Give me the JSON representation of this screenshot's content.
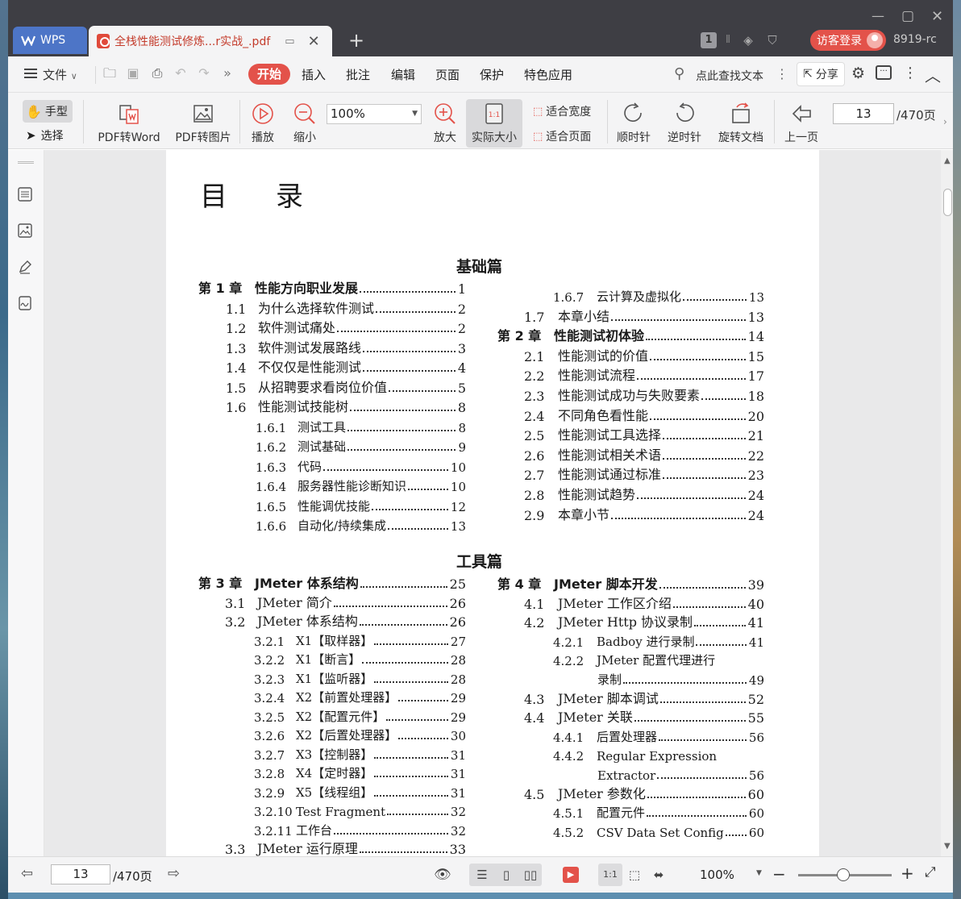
{
  "window": {
    "wps_tab_label": "WPS",
    "doc_tab_title": "全栈性能测试修炼...r实战_.pdf",
    "badge_count": "1",
    "login_label": "访客登录",
    "version": "8919-rc"
  },
  "menu": {
    "file": "文件",
    "items": [
      "开始",
      "插入",
      "批注",
      "编辑",
      "页面",
      "保护",
      "特色应用"
    ],
    "search": "点此查找文本",
    "share": "分享"
  },
  "toolbar": {
    "hand": "手型",
    "select": "选择",
    "pdf_to_word": "PDF转Word",
    "pdf_to_image": "PDF转图片",
    "play": "播放",
    "zoom_out": "缩小",
    "zoom_value": "100%",
    "zoom_in": "放大",
    "actual_size": "实际大小",
    "fit_width": "适合宽度",
    "fit_page": "适合页面",
    "clockwise": "顺时针",
    "counter_clockwise": "逆时针",
    "rotate_doc": "旋转文档",
    "prev_page": "上一页",
    "page_current": "13",
    "page_total": "/470页"
  },
  "document": {
    "title": "目录",
    "section1": "基础篇",
    "section2": "工具篇",
    "left1": [
      {
        "num": "第 1 章",
        "text": "性能方向职业发展",
        "page": "1",
        "type": "ch"
      },
      {
        "num": "1.1",
        "text": "为什么选择软件测试",
        "page": "2",
        "type": "sec"
      },
      {
        "num": "1.2",
        "text": "软件测试痛处",
        "page": "2",
        "type": "sec"
      },
      {
        "num": "1.3",
        "text": "软件测试发展路线",
        "page": "3",
        "type": "sec"
      },
      {
        "num": "1.4",
        "text": "不仅仅是性能测试",
        "page": "4",
        "type": "sec"
      },
      {
        "num": "1.5",
        "text": "从招聘要求看岗位价值",
        "page": "5",
        "type": "sec"
      },
      {
        "num": "1.6",
        "text": "性能测试技能树",
        "page": "8",
        "type": "sec"
      },
      {
        "num": "1.6.1",
        "text": "测试工具",
        "page": "8",
        "type": "sub"
      },
      {
        "num": "1.6.2",
        "text": "测试基础",
        "page": "9",
        "type": "sub"
      },
      {
        "num": "1.6.3",
        "text": "代码",
        "page": "10",
        "type": "sub"
      },
      {
        "num": "1.6.4",
        "text": "服务器性能诊断知识",
        "page": "10",
        "type": "sub"
      },
      {
        "num": "1.6.5",
        "text": "性能调优技能",
        "page": "12",
        "type": "sub"
      },
      {
        "num": "1.6.6",
        "text": "自动化/持续集成",
        "page": "13",
        "type": "sub"
      }
    ],
    "right1": [
      {
        "num": "1.6.7",
        "text": "云计算及虚拟化",
        "page": "13",
        "type": "sub"
      },
      {
        "num": "1.7",
        "text": "本章小结",
        "page": "13",
        "type": "sec"
      },
      {
        "num": "第 2 章",
        "text": "性能测试初体验",
        "page": "14",
        "type": "ch"
      },
      {
        "num": "2.1",
        "text": "性能测试的价值",
        "page": "15",
        "type": "sec"
      },
      {
        "num": "2.2",
        "text": "性能测试流程",
        "page": "17",
        "type": "sec"
      },
      {
        "num": "2.3",
        "text": "性能测试成功与失败要素",
        "page": "18",
        "type": "sec"
      },
      {
        "num": "2.4",
        "text": "不同角色看性能",
        "page": "20",
        "type": "sec"
      },
      {
        "num": "2.5",
        "text": "性能测试工具选择",
        "page": "21",
        "type": "sec"
      },
      {
        "num": "2.6",
        "text": "性能测试相关术语",
        "page": "22",
        "type": "sec"
      },
      {
        "num": "2.7",
        "text": "性能测试通过标准",
        "page": "23",
        "type": "sec"
      },
      {
        "num": "2.8",
        "text": "性能测试趋势",
        "page": "24",
        "type": "sec"
      },
      {
        "num": "2.9",
        "text": "本章小节",
        "page": "24",
        "type": "sec"
      }
    ],
    "left2": [
      {
        "num": "第 3 章",
        "text": "JMeter 体系结构",
        "page": "25",
        "type": "ch"
      },
      {
        "num": "3.1",
        "text": "JMeter 简介",
        "page": "26",
        "type": "sec"
      },
      {
        "num": "3.2",
        "text": "JMeter 体系结构",
        "page": "26",
        "type": "sec"
      },
      {
        "num": "3.2.1",
        "text": "X1【取样器】",
        "page": "27",
        "type": "sub"
      },
      {
        "num": "3.2.2",
        "text": "X1【断言】",
        "page": "28",
        "type": "sub"
      },
      {
        "num": "3.2.3",
        "text": "X1【监听器】",
        "page": "28",
        "type": "sub"
      },
      {
        "num": "3.2.4",
        "text": "X2【前置处理器】",
        "page": "29",
        "type": "sub"
      },
      {
        "num": "3.2.5",
        "text": "X2【配置元件】",
        "page": "29",
        "type": "sub"
      },
      {
        "num": "3.2.6",
        "text": "X2【后置处理器】",
        "page": "30",
        "type": "sub"
      },
      {
        "num": "3.2.7",
        "text": "X3【控制器】",
        "page": "31",
        "type": "sub"
      },
      {
        "num": "3.2.8",
        "text": "X4【定时器】",
        "page": "31",
        "type": "sub"
      },
      {
        "num": "3.2.9",
        "text": "X5【线程组】",
        "page": "31",
        "type": "sub"
      },
      {
        "num": "3.2.10",
        "text": "Test Fragment",
        "page": "32",
        "type": "sub"
      },
      {
        "num": "3.2.11",
        "text": "工作台",
        "page": "32",
        "type": "sub"
      },
      {
        "num": "3.3",
        "text": "JMeter 运行原理",
        "page": "33",
        "type": "sec"
      }
    ],
    "right2": [
      {
        "num": "第 4 章",
        "text": "JMeter 脚本开发",
        "page": "39",
        "type": "ch"
      },
      {
        "num": "4.1",
        "text": "JMeter 工作区介绍",
        "page": "40",
        "type": "sec"
      },
      {
        "num": "4.2",
        "text": "JMeter Http 协议录制",
        "page": "41",
        "type": "sec"
      },
      {
        "num": "4.2.1",
        "text": "Badboy 进行录制",
        "page": "41",
        "type": "sub"
      },
      {
        "num": "4.2.2",
        "text": "JMeter 配置代理进行",
        "page": "",
        "type": "sub"
      },
      {
        "num": "",
        "text": "录制",
        "page": "49",
        "type": "subcont"
      },
      {
        "num": "4.3",
        "text": "JMeter 脚本调试",
        "page": "52",
        "type": "sec"
      },
      {
        "num": "4.4",
        "text": "JMeter 关联",
        "page": "55",
        "type": "sec"
      },
      {
        "num": "4.4.1",
        "text": "后置处理器",
        "page": "56",
        "type": "sub"
      },
      {
        "num": "4.4.2",
        "text": "Regular Expression",
        "page": "",
        "type": "sub"
      },
      {
        "num": "",
        "text": "Extractor",
        "page": "56",
        "type": "subcont"
      },
      {
        "num": "4.5",
        "text": "JMeter 参数化",
        "page": "60",
        "type": "sec"
      },
      {
        "num": "4.5.1",
        "text": "配置元件",
        "page": "60",
        "type": "sub"
      },
      {
        "num": "4.5.2",
        "text": "CSV Data Set Config",
        "page": "60",
        "type": "sub"
      }
    ]
  },
  "statusbar": {
    "page_current": "13",
    "page_total": "/470页",
    "zoom": "100%"
  },
  "colors": {
    "accent_red": "#e3524a",
    "wps_blue": "#4d75c7",
    "title_bar": "#3e3e44"
  }
}
